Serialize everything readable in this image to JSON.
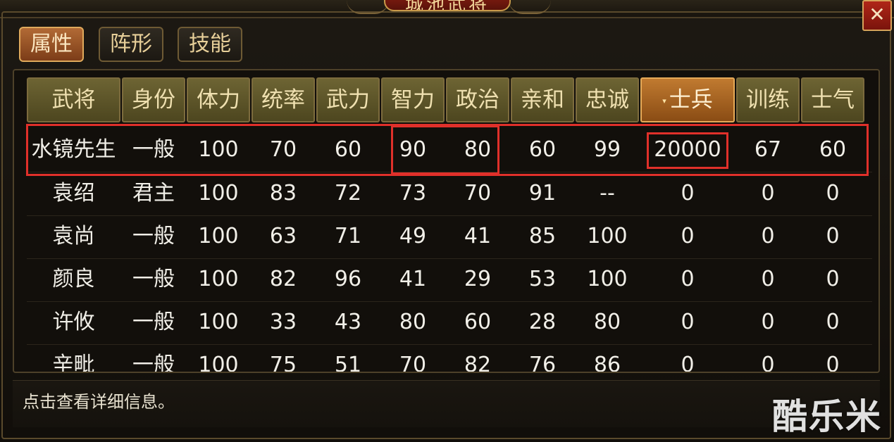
{
  "window": {
    "title": "城池武将",
    "close_glyph": "✕"
  },
  "tabs": [
    {
      "label": "属性",
      "active": true
    },
    {
      "label": "阵形",
      "active": false
    },
    {
      "label": "技能",
      "active": false
    }
  ],
  "table": {
    "headers": [
      "武将",
      "身份",
      "体力",
      "统率",
      "武力",
      "智力",
      "政治",
      "亲和",
      "忠诚",
      "士兵",
      "训练",
      "士气"
    ],
    "sorted_column": "士兵",
    "sort_indicator": "▾",
    "rows": [
      [
        "水镜先生",
        "一般",
        "100",
        "70",
        "60",
        "90",
        "80",
        "60",
        "99",
        "20000",
        "67",
        "60"
      ],
      [
        "袁绍",
        "君主",
        "100",
        "83",
        "72",
        "73",
        "70",
        "91",
        "--",
        "0",
        "0",
        "0"
      ],
      [
        "袁尚",
        "一般",
        "100",
        "63",
        "71",
        "49",
        "41",
        "85",
        "100",
        "0",
        "0",
        "0"
      ],
      [
        "颜良",
        "一般",
        "100",
        "82",
        "96",
        "41",
        "29",
        "53",
        "100",
        "0",
        "0",
        "0"
      ],
      [
        "许攸",
        "一般",
        "100",
        "33",
        "43",
        "80",
        "60",
        "28",
        "80",
        "0",
        "0",
        "0"
      ],
      [
        "辛毗",
        "一般",
        "100",
        "75",
        "51",
        "70",
        "82",
        "76",
        "86",
        "0",
        "0",
        "0"
      ]
    ]
  },
  "footer": {
    "hint": "点击查看详细信息。"
  },
  "watermark": "酷乐米",
  "colors": {
    "highlight": "#e0302a",
    "header_bg": "#5d5528",
    "sorted_header_bg": "#a5621f",
    "active_tab": "#9a5428"
  }
}
